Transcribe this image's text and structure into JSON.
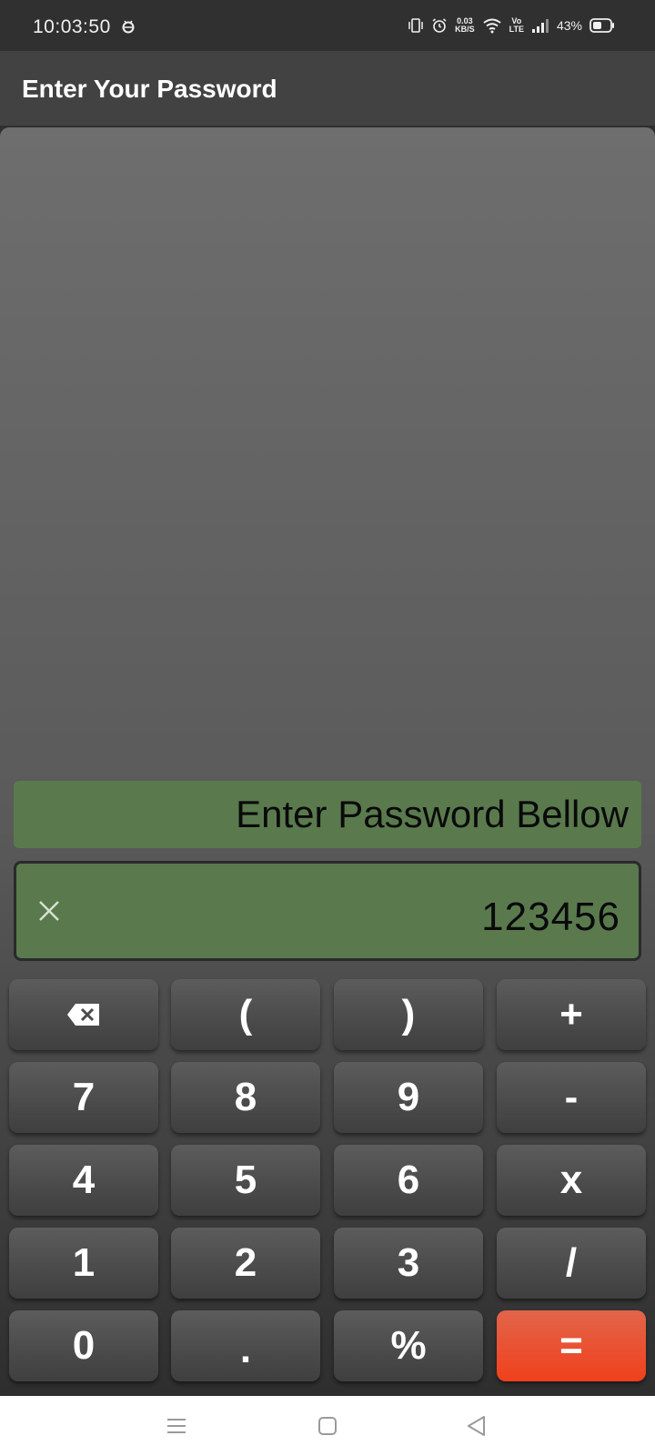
{
  "status_bar": {
    "time": "10:03:50",
    "speed_value": "0.03",
    "speed_unit": "KB/S",
    "volte_top": "Vo",
    "volte_bottom": "LTE",
    "battery": "43%"
  },
  "app_bar": {
    "title": "Enter Your Password"
  },
  "display": {
    "prompt": "Enter Password Bellow",
    "password_value": "123456"
  },
  "keypad": {
    "row1": [
      "(",
      ")",
      "+"
    ],
    "row2": [
      "7",
      "8",
      "9",
      "-"
    ],
    "row3": [
      "4",
      "5",
      "6",
      "x"
    ],
    "row4": [
      "1",
      "2",
      "3",
      "/"
    ],
    "row5": [
      "0",
      ".",
      "%",
      "="
    ]
  },
  "icons": {
    "backspace": "backspace-icon",
    "clear": "close-icon",
    "nav_menu": "menu-icon",
    "nav_home": "home-icon",
    "nav_back": "back-icon"
  },
  "colors": {
    "display_green": "#5a7a4e",
    "equals_accent": "#f0401c",
    "key_gray": "#4a4a4a"
  }
}
